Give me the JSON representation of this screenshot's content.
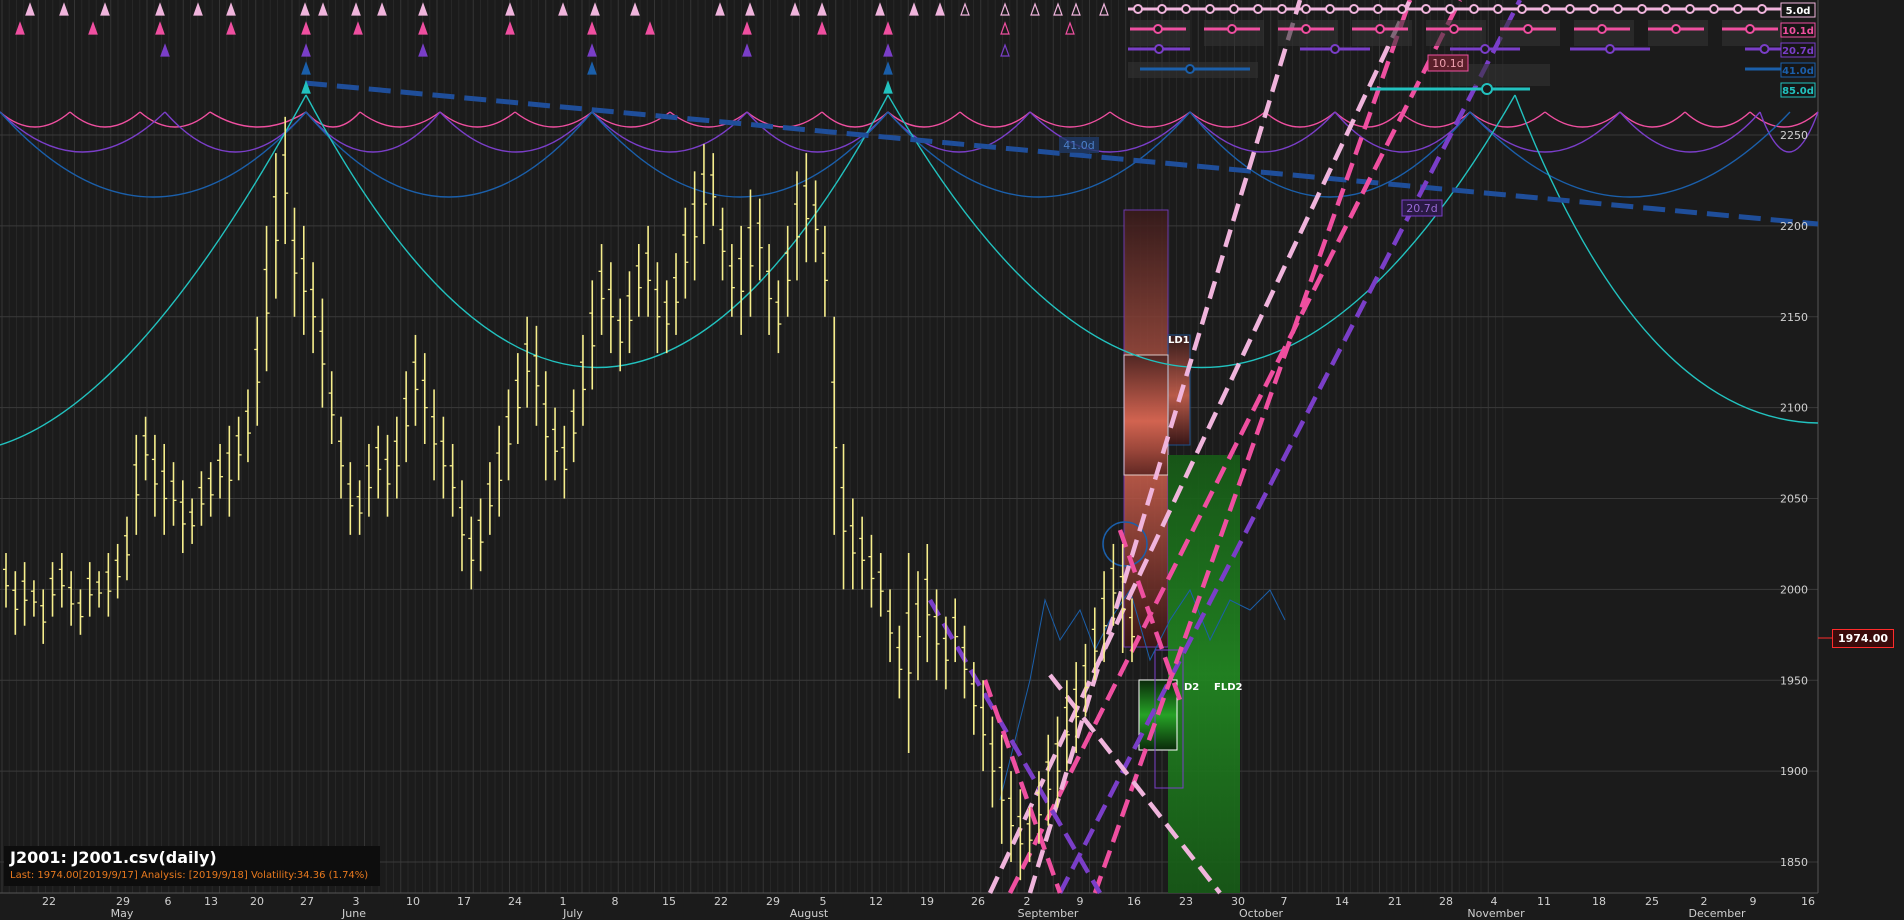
{
  "header": {
    "symbol_line": "J2001: J2001.csv(daily)",
    "status_line": "Last: 1974.00[2019/9/17] Analysis: [2019/9/18] Volatility:34.36 (1.74%)"
  },
  "last_price_label": "1974.00",
  "colors": {
    "background": "#1b1b1b",
    "price_bars": "#f6ee8c",
    "cycle_5d": "#f0b4dc",
    "cycle_10d": "#ef4fa0",
    "cycle_20d": "#7a3ec8",
    "cycle_41d": "#1b5faa",
    "cycle_85d": "#22c2bf",
    "trendline": "#1f4e9a",
    "price_tag_border": "#ff2b2b"
  },
  "chart_data": {
    "type": "bar",
    "title": "J2001: J2001.csv(daily)",
    "x_axis": {
      "type": "date",
      "day_ticks": [
        "22",
        "29",
        "6",
        "13",
        "20",
        "27",
        "3",
        "10",
        "17",
        "24",
        "1",
        "8",
        "15",
        "22",
        "29",
        "5",
        "12",
        "19",
        "26",
        "2",
        "9",
        "16",
        "23",
        "30",
        "7",
        "14",
        "21",
        "28",
        "4",
        "11",
        "18",
        "25",
        "2",
        "9",
        "16"
      ],
      "month_labels": [
        "May",
        "June",
        "July",
        "August",
        "September",
        "October",
        "November",
        "December"
      ]
    },
    "y_axis": {
      "ticks": [
        1850,
        1900,
        1950,
        2000,
        2050,
        2100,
        2150,
        2200,
        2250
      ],
      "range": [
        1835,
        2275
      ],
      "position": "right"
    },
    "grid": true,
    "cycle_labels": [
      "5.0d",
      "10.1d",
      "20.7d",
      "41.0d",
      "85.0d"
    ],
    "chart_annotations": [
      "41.0d",
      "20.7d",
      "10.1d",
      "LD1",
      "D2",
      "FLD2"
    ],
    "period": {
      "start": "2019-05-20",
      "end": "2019-09-17"
    },
    "bars_high_low": [
      [
        2020,
        1990
      ],
      [
        2010,
        1975
      ],
      [
        2015,
        1980
      ],
      [
        2005,
        1985
      ],
      [
        2000,
        1970
      ],
      [
        2015,
        1985
      ],
      [
        2020,
        1990
      ],
      [
        2010,
        1980
      ],
      [
        2000,
        1975
      ],
      [
        2015,
        1985
      ],
      [
        2010,
        1990
      ],
      [
        2020,
        1985
      ],
      [
        2025,
        1995
      ],
      [
        2040,
        2005
      ],
      [
        2085,
        2030
      ],
      [
        2095,
        2060
      ],
      [
        2085,
        2040
      ],
      [
        2080,
        2030
      ],
      [
        2070,
        2035
      ],
      [
        2060,
        2020
      ],
      [
        2050,
        2025
      ],
      [
        2065,
        2035
      ],
      [
        2070,
        2040
      ],
      [
        2080,
        2050
      ],
      [
        2090,
        2040
      ],
      [
        2095,
        2060
      ],
      [
        2110,
        2070
      ],
      [
        2150,
        2090
      ],
      [
        2200,
        2120
      ],
      [
        2240,
        2160
      ],
      [
        2260,
        2190
      ],
      [
        2210,
        2150
      ],
      [
        2200,
        2140
      ],
      [
        2180,
        2130
      ],
      [
        2160,
        2100
      ],
      [
        2120,
        2080
      ],
      [
        2095,
        2050
      ],
      [
        2070,
        2030
      ],
      [
        2060,
        2030
      ],
      [
        2080,
        2040
      ],
      [
        2090,
        2050
      ],
      [
        2085,
        2040
      ],
      [
        2095,
        2050
      ],
      [
        2120,
        2070
      ],
      [
        2140,
        2090
      ],
      [
        2130,
        2080
      ],
      [
        2110,
        2060
      ],
      [
        2095,
        2050
      ],
      [
        2080,
        2040
      ],
      [
        2060,
        2010
      ],
      [
        2040,
        2000
      ],
      [
        2050,
        2010
      ],
      [
        2070,
        2030
      ],
      [
        2090,
        2040
      ],
      [
        2110,
        2060
      ],
      [
        2130,
        2080
      ],
      [
        2150,
        2100
      ],
      [
        2145,
        2090
      ],
      [
        2120,
        2060
      ],
      [
        2100,
        2060
      ],
      [
        2090,
        2050
      ],
      [
        2110,
        2070
      ],
      [
        2140,
        2090
      ],
      [
        2170,
        2110
      ],
      [
        2190,
        2140
      ],
      [
        2180,
        2130
      ],
      [
        2160,
        2120
      ],
      [
        2175,
        2130
      ],
      [
        2190,
        2150
      ],
      [
        2200,
        2150
      ],
      [
        2180,
        2130
      ],
      [
        2170,
        2130
      ],
      [
        2185,
        2140
      ],
      [
        2210,
        2160
      ],
      [
        2230,
        2170
      ],
      [
        2245,
        2190
      ],
      [
        2240,
        2200
      ],
      [
        2210,
        2170
      ],
      [
        2190,
        2150
      ],
      [
        2200,
        2140
      ],
      [
        2220,
        2150
      ],
      [
        2215,
        2170
      ],
      [
        2190,
        2140
      ],
      [
        2170,
        2130
      ],
      [
        2200,
        2150
      ],
      [
        2230,
        2170
      ],
      [
        2240,
        2180
      ],
      [
        2225,
        2180
      ],
      [
        2200,
        2150
      ],
      [
        2150,
        2030
      ],
      [
        2080,
        2000
      ],
      [
        2050,
        2000
      ],
      [
        2040,
        2000
      ],
      [
        2030,
        1990
      ],
      [
        2020,
        1985
      ],
      [
        2000,
        1960
      ],
      [
        1980,
        1940
      ],
      [
        2020,
        1910
      ],
      [
        2010,
        1950
      ],
      [
        2025,
        1960
      ],
      [
        2000,
        1950
      ],
      [
        1985,
        1945
      ],
      [
        1995,
        1960
      ],
      [
        1980,
        1940
      ],
      [
        1960,
        1920
      ],
      [
        1950,
        1900
      ],
      [
        1930,
        1880
      ],
      [
        1920,
        1860
      ],
      [
        1900,
        1850
      ],
      [
        1890,
        1840
      ],
      [
        1880,
        1850
      ],
      [
        1900,
        1860
      ],
      [
        1920,
        1870
      ],
      [
        1930,
        1880
      ],
      [
        1950,
        1900
      ],
      [
        1960,
        1910
      ],
      [
        1970,
        1930
      ],
      [
        1990,
        1950
      ],
      [
        2010,
        1960
      ],
      [
        2025,
        1980
      ],
      [
        2025,
        1965
      ],
      [
        1995,
        1960
      ]
    ]
  }
}
